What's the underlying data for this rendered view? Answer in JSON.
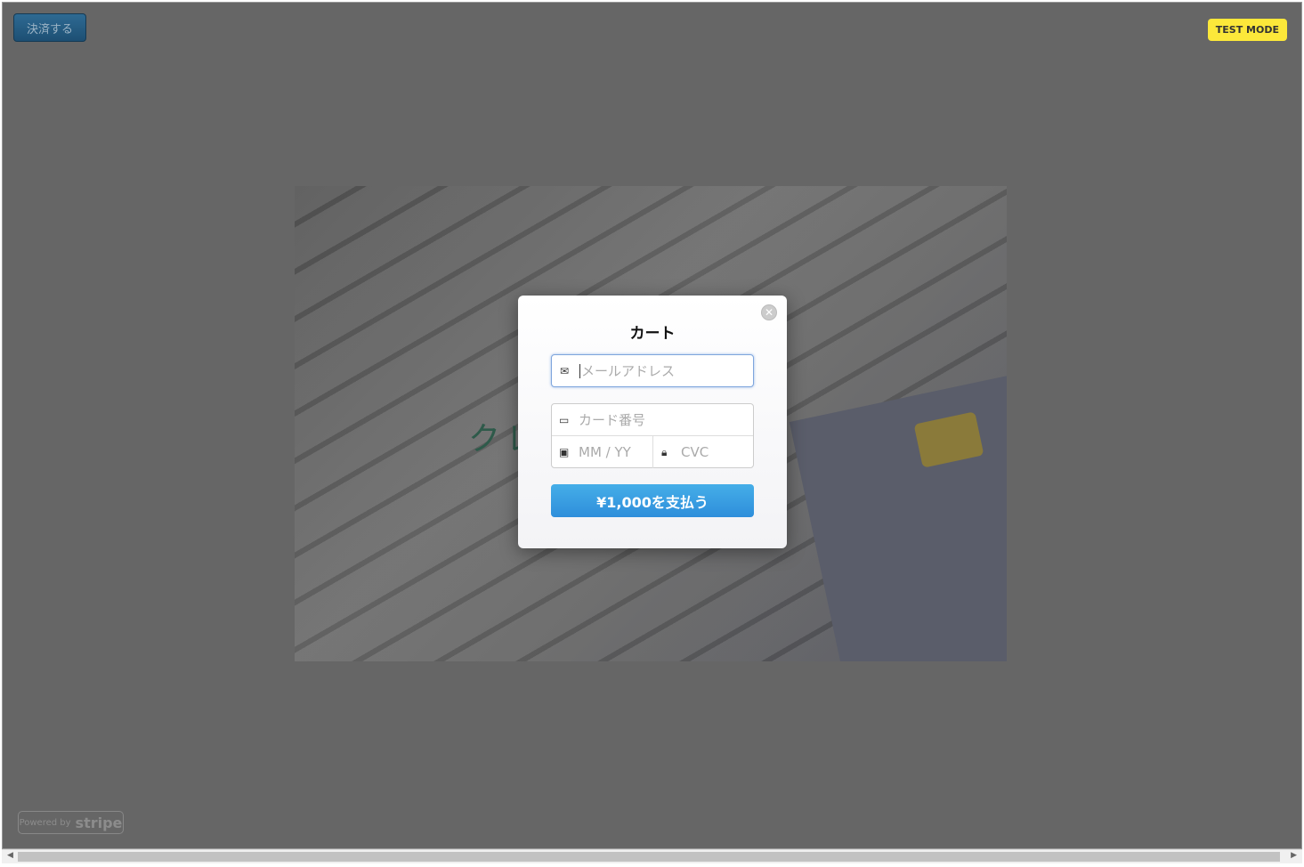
{
  "top": {
    "pay_button": "決済する",
    "test_mode": "TEST MODE"
  },
  "hero": {
    "title": "クレジット決済へ"
  },
  "modal": {
    "title": "カート",
    "close_icon": "close-icon",
    "email_placeholder": "メールアドレス",
    "card_placeholder": "カード番号",
    "expiry_placeholder": "MM / YY",
    "cvc_placeholder": "CVC",
    "submit_label": "¥1,000を支払う"
  },
  "footer": {
    "powered_by": "Powered by",
    "brand": "stripe"
  },
  "colors": {
    "accent": "#3a9fe2",
    "test_badge": "#fce83a",
    "overlay": "#666666"
  }
}
